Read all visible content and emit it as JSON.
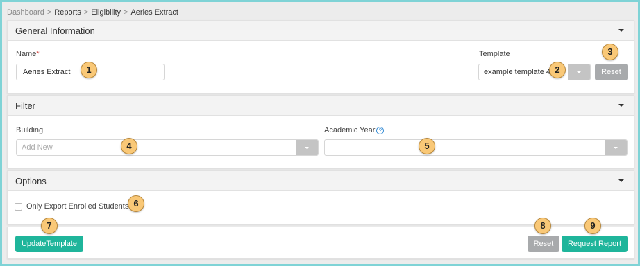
{
  "breadcrumb": {
    "items": [
      "Dashboard",
      "Reports",
      "Eligibility",
      "Aeries Extract"
    ],
    "separator": ">"
  },
  "general": {
    "title": "General Information",
    "name_label": "Name",
    "required_mark": "*",
    "name_value": "Aeries Extract",
    "template_label": "Template",
    "template_value": "example template 4",
    "reset_label": "Reset"
  },
  "filter": {
    "title": "Filter",
    "building_label": "Building",
    "building_placeholder": "Add New",
    "academic_year_label": "Academic Year",
    "help_glyph": "?",
    "academic_year_value": ""
  },
  "options": {
    "title": "Options",
    "only_enrolled_label": "Only Export Enrolled Students",
    "only_enrolled_checked": false
  },
  "footer": {
    "update_template_label": "UpdateTemplate",
    "reset_label": "Reset",
    "request_report_label": "Request Report"
  },
  "callouts": [
    "1",
    "2",
    "3",
    "4",
    "5",
    "6",
    "7",
    "8",
    "9"
  ],
  "colors": {
    "teal": "#1fb59b",
    "gray_button": "#a8aaac",
    "callout": "#f9c877",
    "border_accent": "#7fd3d6"
  }
}
